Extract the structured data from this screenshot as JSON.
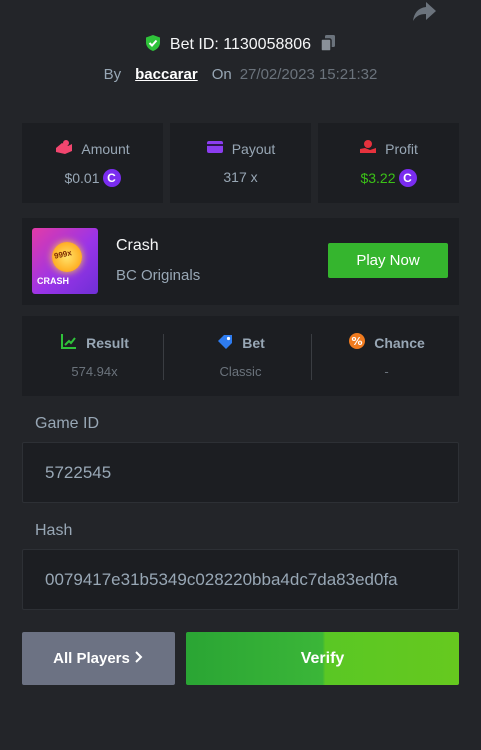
{
  "header": {
    "bet_id_text": "Bet ID: 1130058806",
    "by_label": "By",
    "username": "baccarar",
    "on_label": "On",
    "datetime": "27/02/2023 15:21:32"
  },
  "stats": {
    "amount": {
      "label": "Amount",
      "value": "$0.01"
    },
    "payout": {
      "label": "Payout",
      "value": "317 x"
    },
    "profit": {
      "label": "Profit",
      "value": "$3.22"
    },
    "coin_symbol": "C"
  },
  "game": {
    "title": "Crash",
    "subtitle": "BC Originals",
    "thumbnail_multiplier": "999x",
    "thumbnail_label": "CRASH",
    "play_button": "Play Now"
  },
  "result": {
    "result": {
      "label": "Result",
      "value": "574.94x"
    },
    "bet": {
      "label": "Bet",
      "value": "Classic"
    },
    "chance": {
      "label": "Chance",
      "value": "-"
    }
  },
  "fields": {
    "game_id_label": "Game ID",
    "game_id_value": "5722545",
    "hash_label": "Hash",
    "hash_value": "0079417e31b5349c028220bba4dc7da83ed0fa"
  },
  "actions": {
    "all_players": "All Players",
    "verify": "Verify"
  },
  "colors": {
    "background": "#232529",
    "card": "#1c1e22",
    "green": "#35b52e",
    "profit_green": "#3bc117",
    "coin_purple": "#7a2cf0",
    "muted": "#98a7b5"
  },
  "icons": [
    "share-icon",
    "shield-check-icon",
    "copy-icon",
    "amount-icon",
    "wallet-icon",
    "profit-icon",
    "result-chart-icon",
    "bet-tag-icon",
    "percent-icon",
    "chevron-right-icon"
  ]
}
